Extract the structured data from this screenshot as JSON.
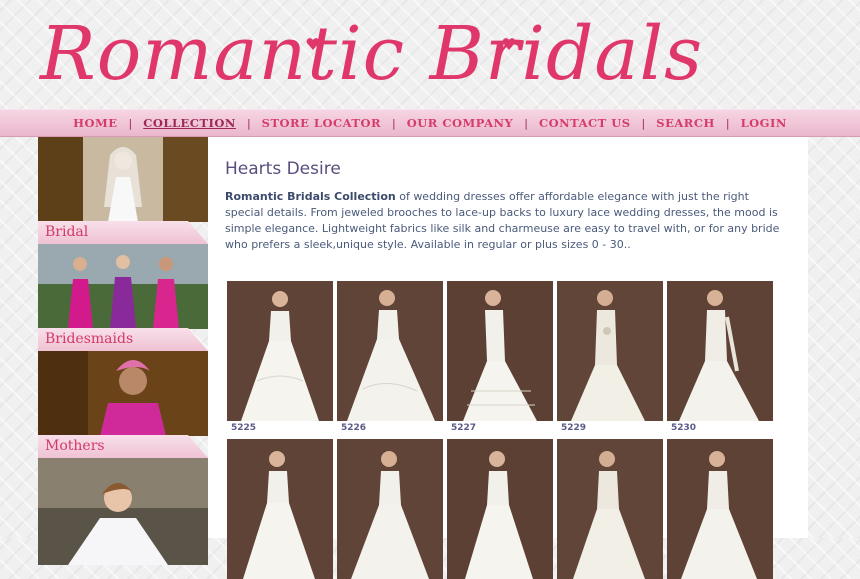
{
  "site": {
    "logo_text": "Romantic Bridals"
  },
  "nav": {
    "items": [
      {
        "label": "HOME",
        "active": false
      },
      {
        "label": "COLLECTION",
        "active": true
      },
      {
        "label": "STORE LOCATOR",
        "active": false
      },
      {
        "label": "OUR COMPANY",
        "active": false
      },
      {
        "label": "CONTACT US",
        "active": false
      },
      {
        "label": "SEARCH",
        "active": false
      },
      {
        "label": "LOGIN",
        "active": false
      }
    ],
    "separator": "|"
  },
  "sidebar": {
    "categories": [
      {
        "label": "Bridal"
      },
      {
        "label": "Bridesmaids"
      },
      {
        "label": "Mothers"
      },
      {
        "label": ""
      }
    ]
  },
  "content": {
    "title": "Hearts Desire",
    "intro_bold": "Romantic Bridals Collection",
    "intro_rest": " of wedding dresses offer affordable elegance with just the right special details. From jeweled brooches to lace-up backs to luxury lace wedding dresses, the mood is simple elegance. Lightweight fabrics like silk and charmeuse are easy to travel with, or for any bride who prefers a sleek,unique style. Available in regular or plus sizes 0 - 30.."
  },
  "gallery": {
    "row1": [
      "5225",
      "5226",
      "5227",
      "5229",
      "5230"
    ],
    "row2": [
      "",
      "",
      "",
      "",
      ""
    ]
  },
  "colors": {
    "brand": "#e0376b",
    "nav_bg": "#eab7cc",
    "title": "#5a4e7c",
    "text": "#4a5a7a"
  }
}
